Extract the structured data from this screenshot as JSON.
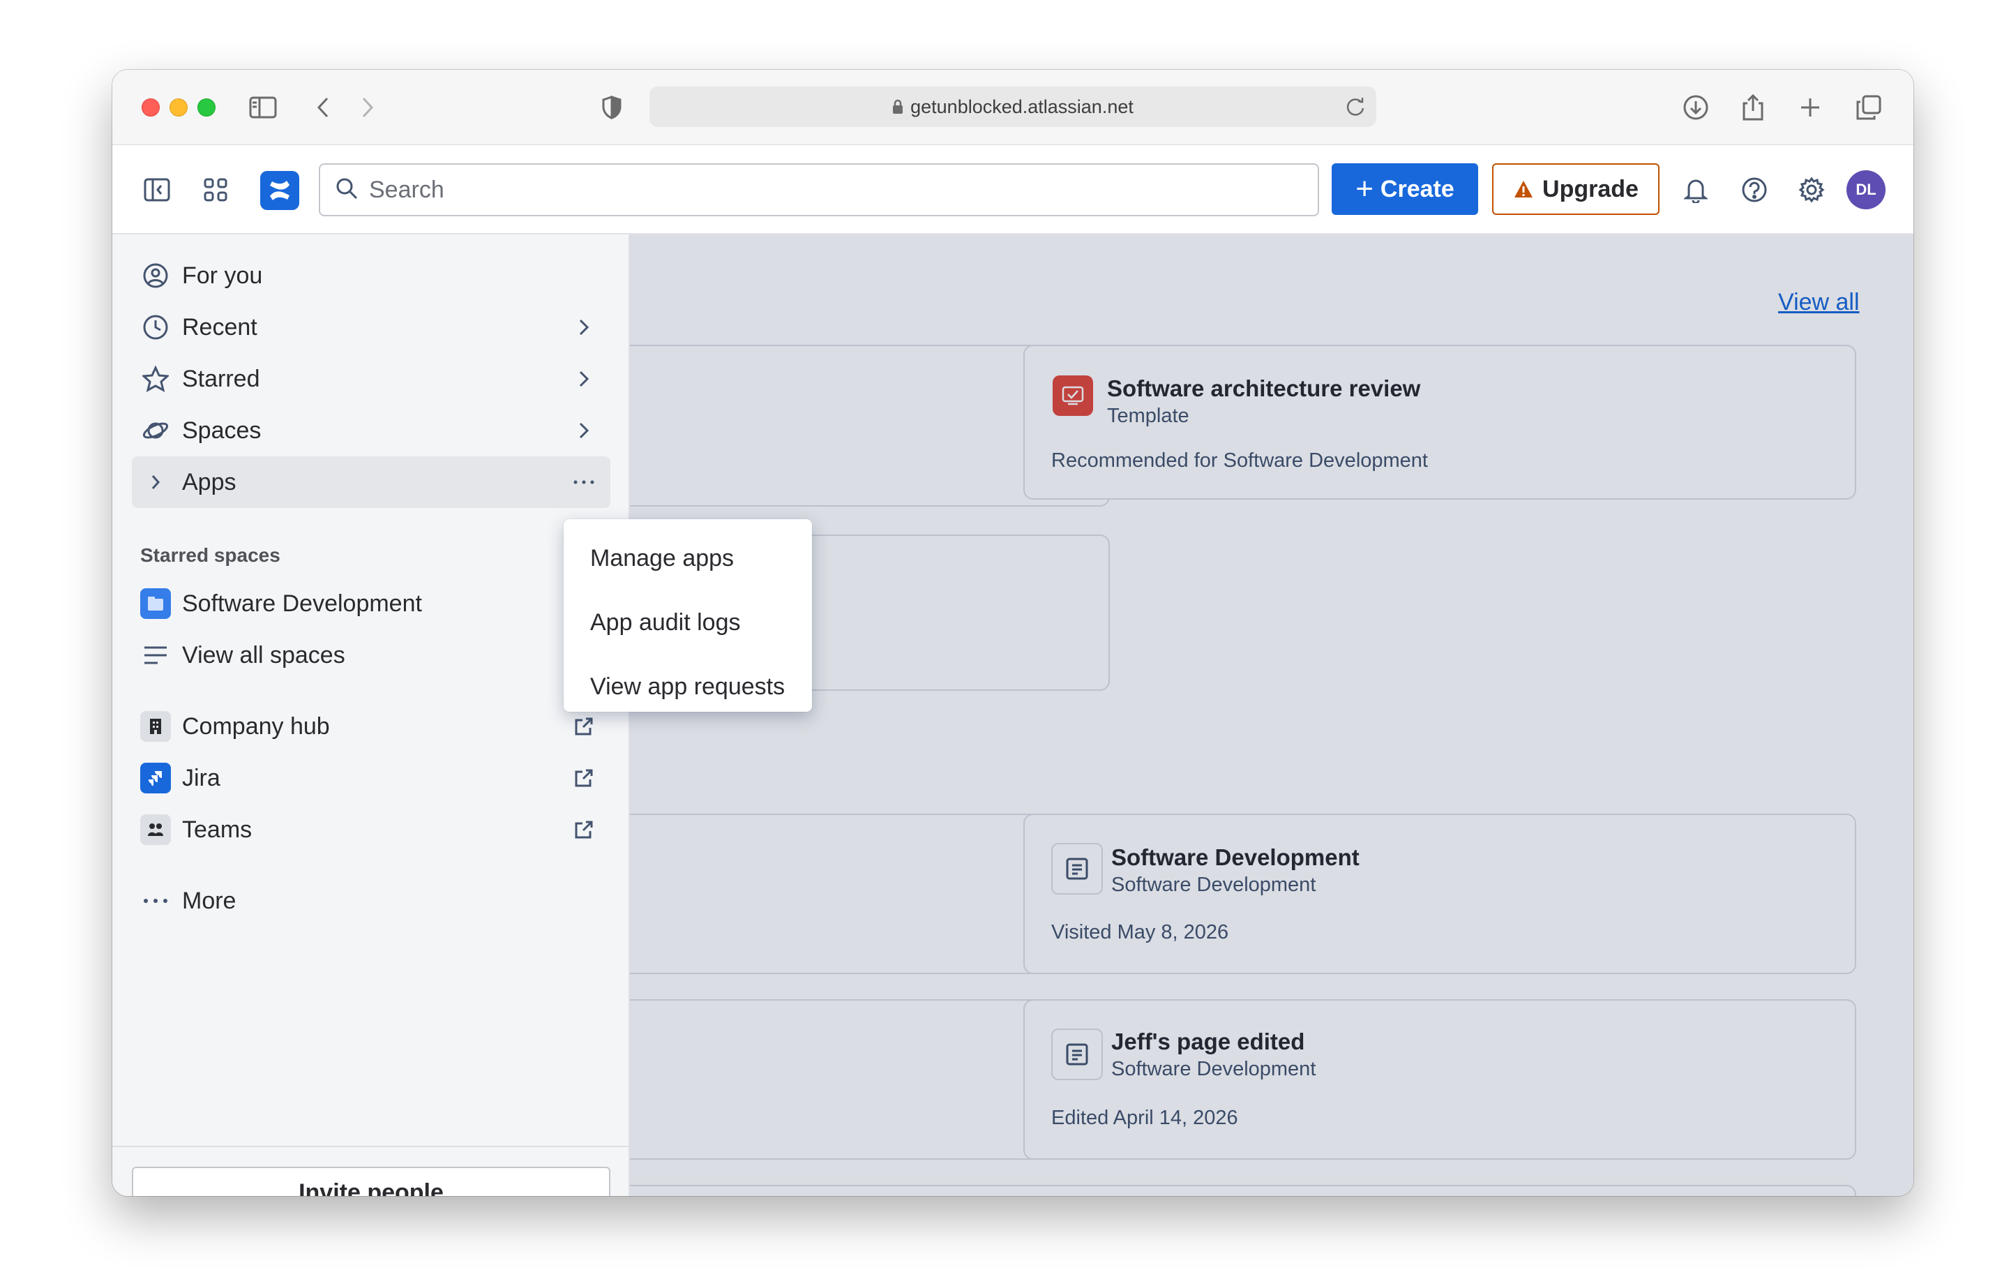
{
  "browser": {
    "url": "getunblocked.atlassian.net"
  },
  "header": {
    "search_placeholder": "Search",
    "create_label": "Create",
    "upgrade_label": "Upgrade",
    "avatar_initials": "DL",
    "brand_color": "#1868db",
    "upgrade_color": "#c25100"
  },
  "sidebar": {
    "nav": [
      {
        "label": "For you",
        "icon": "person-circle-icon"
      },
      {
        "label": "Recent",
        "icon": "clock-icon"
      },
      {
        "label": "Starred",
        "icon": "star-icon"
      },
      {
        "label": "Spaces",
        "icon": "planet-icon"
      },
      {
        "label": "Apps",
        "icon": "chevron-right-icon"
      }
    ],
    "starred_spaces_label": "Starred spaces",
    "starred_space": "Software Development",
    "view_all_spaces": "View all spaces",
    "links": [
      {
        "label": "Company hub",
        "icon": "building-icon"
      },
      {
        "label": "Jira",
        "icon": "jira-icon"
      },
      {
        "label": "Teams",
        "icon": "teams-icon"
      }
    ],
    "more_label": "More",
    "invite_label": "Invite people"
  },
  "apps_menu": {
    "items": [
      "Manage apps",
      "App audit logs",
      "View app requests"
    ]
  },
  "main": {
    "view_all": "View all",
    "cards": [
      {
        "title": "Software architecture review",
        "subtitle": "Template",
        "meta": "Recommended for Software Development",
        "icon": "template-icon"
      },
      {
        "title": "Software Development",
        "subtitle": "Software Development",
        "meta": "Visited May 8, 2026",
        "icon": "page-icon"
      },
      {
        "title": "Jeff's page edited",
        "subtitle": "Software Development",
        "meta": "Edited April 14, 2026",
        "icon": "page-icon"
      }
    ]
  }
}
